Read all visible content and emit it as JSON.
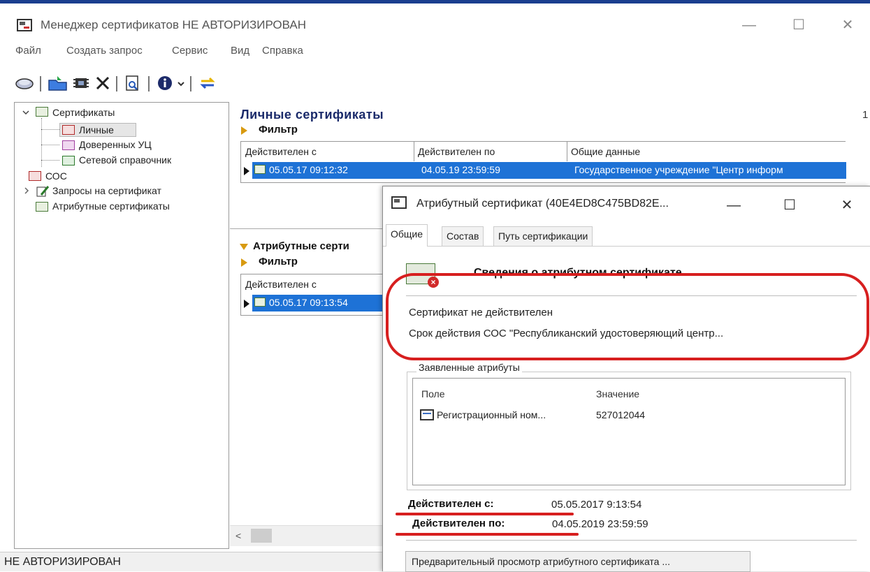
{
  "app": {
    "title": "Менеджер сертификатов  НЕ АВТОРИЗИРОВАН",
    "window_buttons": {
      "minimize": "—",
      "maximize": "☐",
      "close": "✕"
    }
  },
  "menu": [
    "Файл",
    "Создать запрос",
    "Сервис",
    "Вид",
    "Справка"
  ],
  "toolbar": {
    "icons": [
      "book-icon",
      "open-folder-icon",
      "chip-icon",
      "delete-icon",
      "preview-icon",
      "info-icon",
      "dropdown-arrow-icon",
      "sync-arrows-icon"
    ]
  },
  "tree": {
    "root": "Сертификаты",
    "children": [
      "Личные",
      "Доверенных УЦ",
      "Сетевой справочник"
    ],
    "other": [
      "СОС",
      "Запросы на сертификат",
      "Атрибутные сертификаты"
    ]
  },
  "personal": {
    "title": "Личные сертификаты",
    "count": "1",
    "filter": "Фильтр",
    "columns": [
      "Действителен с",
      "Действителен по",
      "Общие данные"
    ],
    "row": [
      "05.05.17 09:12:32",
      "04.05.19 23:59:59",
      "Государственное учреждение \"Центр информ"
    ]
  },
  "attr": {
    "title": "Атрибутные серти",
    "filter": "Фильтр",
    "column": "Действителен с",
    "row": "05.05.17 09:13:54"
  },
  "status": "НЕ АВТОРИЗИРОВАН",
  "dialog": {
    "title": "Атрибутный сертификат (40E4ED8C475BD82E...",
    "tabs": [
      "Общие",
      "Состав",
      "Путь сертификации"
    ],
    "heading": "Сведения о атрибутном сертификате",
    "line1": "Сертификат не действителен",
    "line2": "Срок действия СОС \"Республиканский удостоверяющий центр...",
    "group_label": "Заявленные атрибуты",
    "col_field": "Поле",
    "col_value": "Значение",
    "attr_field": "Регистрационный ном...",
    "attr_value": "527012044",
    "valid_from_label": "Действителен с:",
    "valid_from": "05.05.2017 9:13:54",
    "valid_to_label": "Действителен по:",
    "valid_to": "04.05.2019 23:59:59",
    "preview_button": "Предварительный просмотр атрибутного сертификата ..."
  },
  "colors": {
    "selection": "#1e72d6",
    "annotation": "#d71f1f",
    "filter_arrow": "#d89a10"
  }
}
